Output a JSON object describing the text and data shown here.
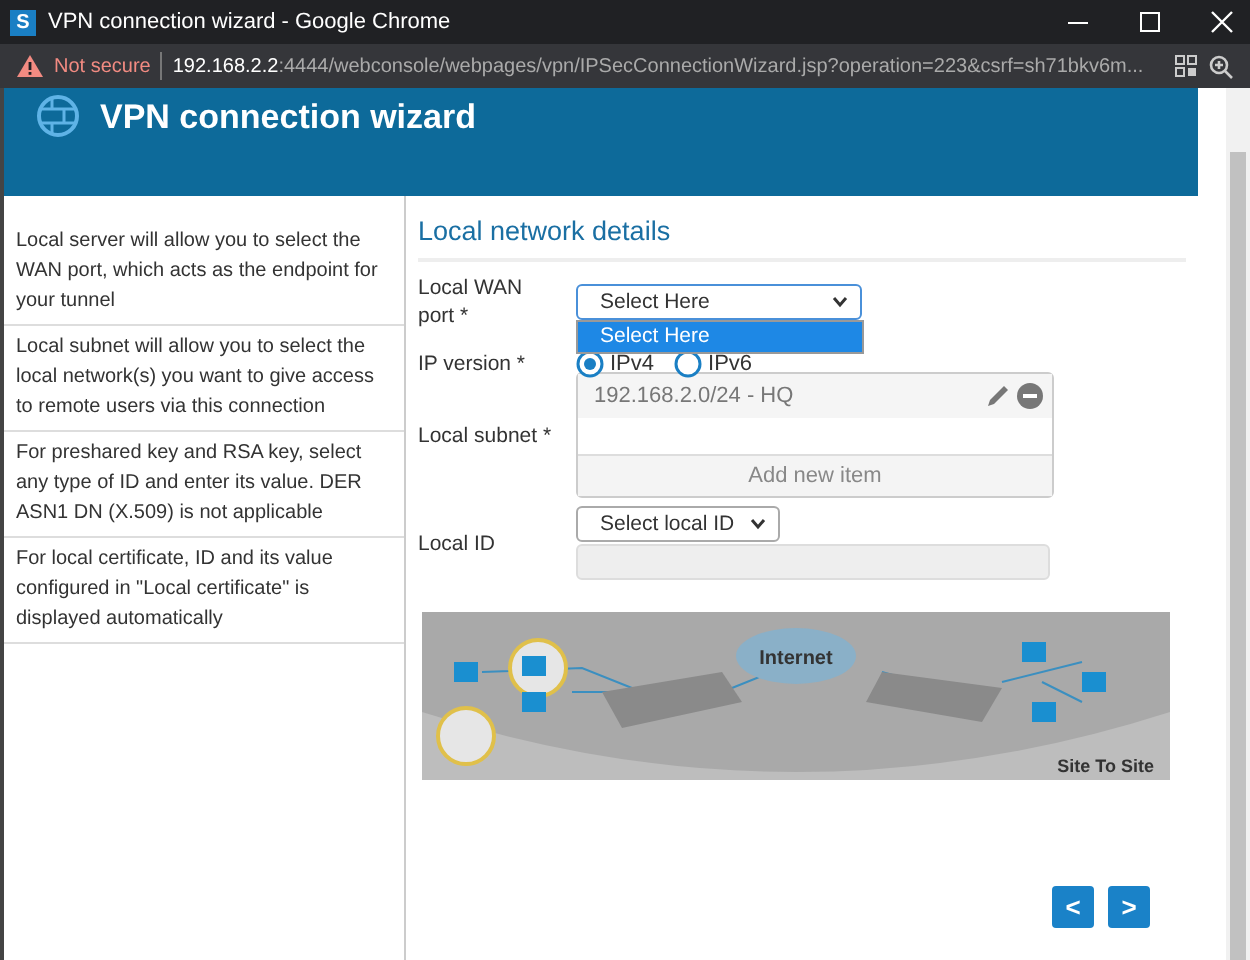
{
  "browser": {
    "title": "VPN connection wizard - Google Chrome",
    "app_letter": "S",
    "security": "Not secure",
    "url_host": "192.168.2.2",
    "url_rest": ":4444/webconsole/webpages/vpn/IPSecConnectionWizard.jsp?operation=223&csrf=sh71bkv6m..."
  },
  "wizard": {
    "title": "VPN connection wizard"
  },
  "help": [
    "Local server will allow you to select the WAN port, which acts as the endpoint for your tunnel",
    "Local subnet will allow you to select the local network(s) you want to give access to remote users via this connection",
    "For preshared key and RSA key, select any type of ID and enter its value. DER ASN1 DN (X.509) is not applicable",
    "For local certificate, ID and its value configured in \"Local certificate\" is displayed automatically"
  ],
  "section_title": "Local network details",
  "wan_port": {
    "label": "Local WAN port *",
    "value": "Select Here",
    "options": [
      {
        "label": "Select Here",
        "selected": true
      }
    ]
  },
  "ip_version": {
    "label": "IP version *",
    "options": [
      {
        "label": "IPv4",
        "selected": true
      },
      {
        "label": "IPv6",
        "selected": false
      }
    ]
  },
  "local_subnet": {
    "label": "Local subnet *",
    "items": [
      "192.168.2.0/24 - HQ"
    ],
    "add_label": "Add new item"
  },
  "local_id": {
    "label": "Local ID",
    "value": "Select local ID"
  },
  "diagram": {
    "cloud_label": "Internet",
    "caption": "Site To Site"
  },
  "nav": {
    "prev": "<",
    "next": ">"
  }
}
